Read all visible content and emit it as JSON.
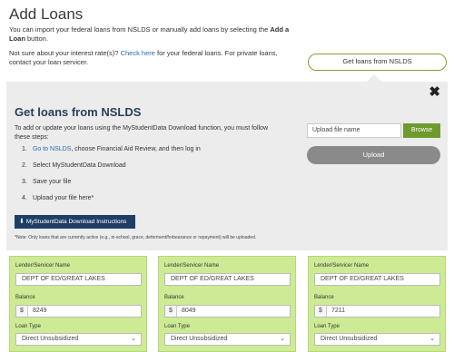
{
  "header": {
    "title": "Add Loans",
    "intro_text": "You can import your federal loans from NSLDS or manually add loans by selecting the ",
    "intro_bold": "Add a Loan",
    "intro_end": " button.",
    "rate_text_pre": "Not sure about your interest rate(s)? ",
    "rate_link": "Check here",
    "rate_text_post": " for your federal loans. For private loans, contact your loan servicer.",
    "get_loans_button": "Get loans from NSLDS"
  },
  "panel": {
    "title": "Get loans from NSLDS",
    "description": "To add or update your loans using the MyStudentData Download function, you must follow these steps:",
    "steps": [
      {
        "num": "1.",
        "link": "Go to NSLDS",
        "text": ", choose Financial Aid Review, and then log in"
      },
      {
        "num": "2.",
        "text": "Select MyStudentData Download"
      },
      {
        "num": "3.",
        "text": "Save your file"
      },
      {
        "num": "4.",
        "text": "Upload your file here*"
      }
    ],
    "file_placeholder": "Upload file name",
    "browse_button": "Browse",
    "upload_button": "Upload",
    "download_button": "MyStudentData Download Instructions",
    "note": "*Note: Only loans that are currently active (e.g., in-school, grace, deferment/forbearance or repayment) will be uploaded.",
    "close_symbol": "✖"
  },
  "cards": [
    {
      "lender_label": "Lender/Servicer Name",
      "lender": "DEPT OF ED/GREAT LAKES",
      "balance_label": "Balance",
      "currency": "$",
      "balance": "8249",
      "loan_type_label": "Loan Type",
      "loan_type": "Direct Unsubsidized"
    },
    {
      "lender_label": "Lender/Servicer Name",
      "lender": "DEPT OF ED/GREAT LAKES",
      "balance_label": "Balance",
      "currency": "$",
      "balance": "8049",
      "loan_type_label": "Loan Type",
      "loan_type": "Direct Unsubsidized"
    },
    {
      "lender_label": "Lender/Servicer Name",
      "lender": "DEPT OF ED/GREAT LAKES",
      "balance_label": "Balance",
      "currency": "$",
      "balance": "7211",
      "loan_type_label": "Loan Type",
      "loan_type": "Direct Unsubsidized"
    }
  ],
  "colors": {
    "accent_green": "#6e9a2f",
    "card_green": "#cdeb94",
    "navy": "#1f3e66",
    "link_blue": "#2a6bb3"
  },
  "icons": {
    "close": "close-icon",
    "download": "download-icon",
    "chevron": "chevron-down-icon"
  }
}
